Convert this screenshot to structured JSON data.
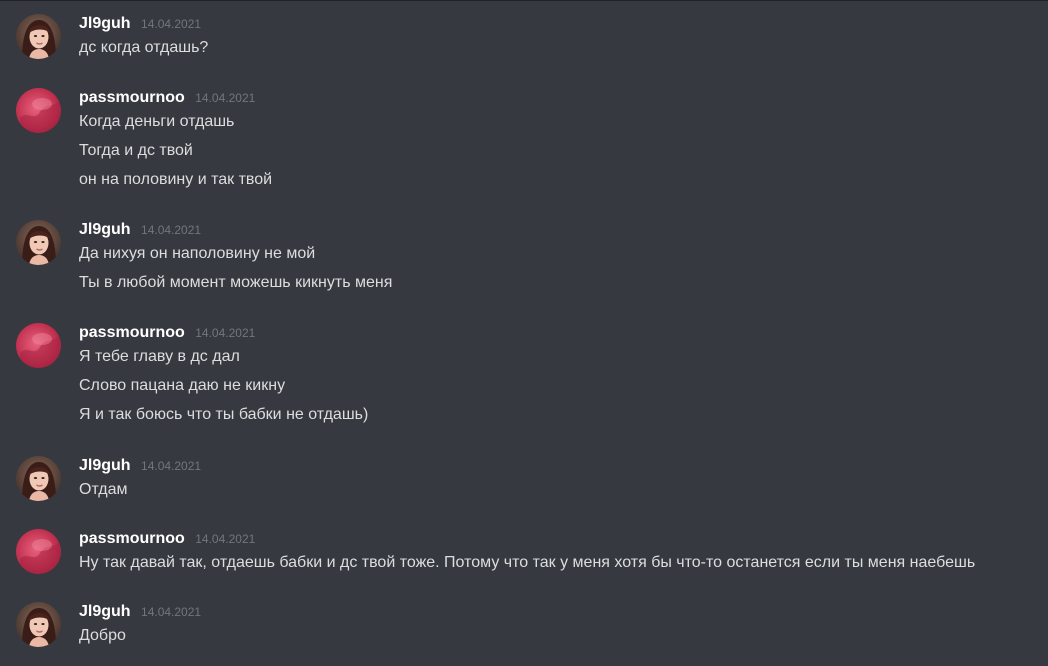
{
  "messages": [
    {
      "author": "Jl9guh",
      "avatar": "girl-avatar-icon",
      "timestamp": "14.04.2021",
      "lines": [
        "дс когда отдашь?"
      ]
    },
    {
      "author": "passmournoo",
      "avatar": "pink-blur-avatar-icon",
      "timestamp": "14.04.2021",
      "lines": [
        "Когда деньги отдашь",
        "Тогда и дс твой",
        "он на половину и так твой"
      ]
    },
    {
      "author": "Jl9guh",
      "avatar": "girl-avatar-icon",
      "timestamp": "14.04.2021",
      "lines": [
        "Да нихуя он наполовину не мой",
        "Ты в любой момент можешь кикнуть меня"
      ]
    },
    {
      "author": "passmournoo",
      "avatar": "pink-blur-avatar-icon",
      "timestamp": "14.04.2021",
      "lines": [
        "Я тебе главу в дс дал",
        "Слово пацана даю не кикну",
        "Я и так боюсь что ты бабки не отдашь)"
      ]
    },
    {
      "author": "Jl9guh",
      "avatar": "girl-avatar-icon",
      "timestamp": "14.04.2021",
      "lines": [
        "Отдам"
      ]
    },
    {
      "author": "passmournoo",
      "avatar": "pink-blur-avatar-icon",
      "timestamp": "14.04.2021",
      "lines": [
        "Ну так давай так, отдаешь бабки и дс твой тоже. Потому что так у меня хотя бы что-то останется если ты меня наебешь"
      ]
    },
    {
      "author": "Jl9guh",
      "avatar": "girl-avatar-icon",
      "timestamp": "14.04.2021",
      "lines": [
        "Добро"
      ]
    }
  ],
  "colors": {
    "background": "#36393f",
    "username": "#ffffff",
    "message_text": "#dcddde",
    "timestamp": "#72767d"
  }
}
